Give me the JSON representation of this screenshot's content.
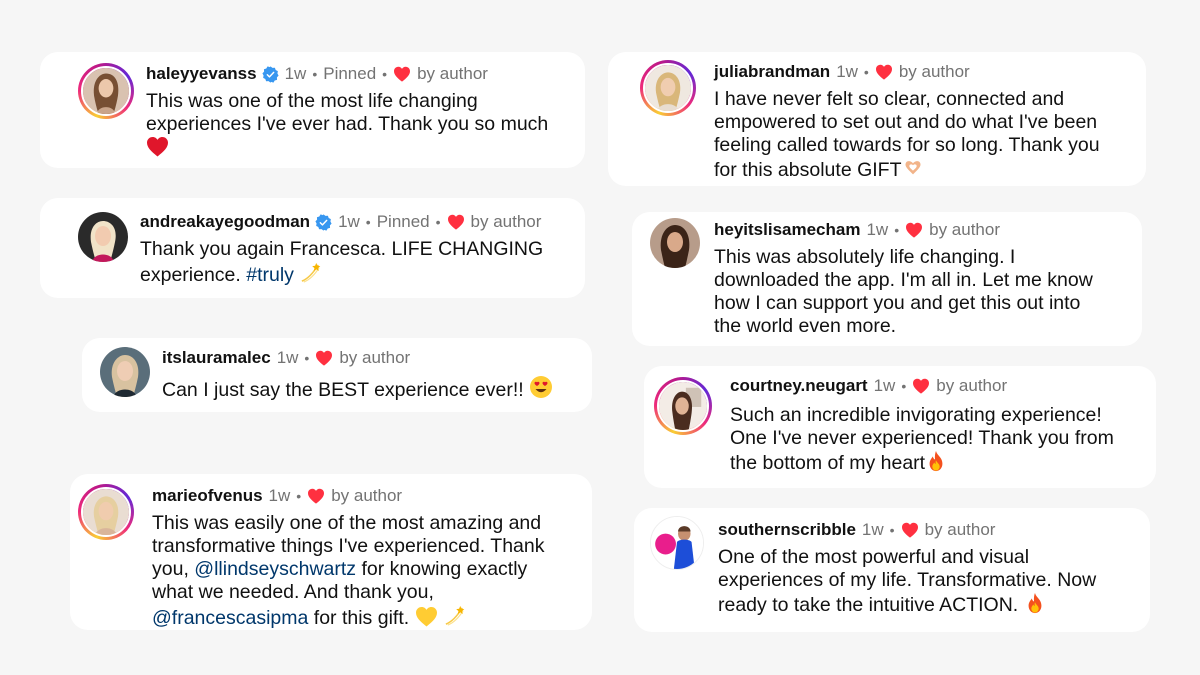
{
  "comments": [
    {
      "username": "haleyyevanss",
      "verified": true,
      "time": "1w",
      "pinned": "Pinned",
      "liked_by": "by author",
      "text_1": "This was one of the most life changing",
      "text_2": "experiences I've ever had. Thank you so much",
      "emoji": "red-heart"
    },
    {
      "username": "andreakayegoodman",
      "verified": true,
      "time": "1w",
      "pinned": "Pinned",
      "liked_by": "by author",
      "text_1": "Thank you again Francesca. LIFE CHANGING",
      "text_2": "experience.",
      "hashtag": "#truly",
      "emoji": "dizzy"
    },
    {
      "username": "itslauramalec",
      "time": "1w",
      "liked_by": "by author",
      "text_1": "Can I just say the BEST experience ever!!",
      "emoji": "heart-eyes"
    },
    {
      "username": "marieofvenus",
      "time": "1w",
      "liked_by": "by author",
      "text_1": "This was easily one of the most amazing and",
      "text_2": "transformative things I've experienced.  Thank",
      "text_3a": "you,",
      "mention_1": "@llindseyschwartz",
      "text_3b": "for knowing exactly",
      "text_4": "what we needed.  And thank you,",
      "mention_2": "@francescasipma",
      "text_5": "for this gift.",
      "emoji": "yellow-heart, dizzy"
    },
    {
      "username": "juliabrandman",
      "time": "1w",
      "liked_by": "by author",
      "text_1": "I have never felt so clear, connected and",
      "text_2": "empowered to set out and do what I've been",
      "text_3": "feeling called towards for so long. Thank you",
      "text_4": "for this absolute GIFT",
      "emoji": "heart-hands"
    },
    {
      "username": "heyitslisamecham",
      "time": "1w",
      "liked_by": "by author",
      "text_1": "This was absolutely life changing. I",
      "text_2": "downloaded the app. I'm all in. Let me know",
      "text_3": "how I can support you and get this out into",
      "text_4": "the world even more."
    },
    {
      "username": "courtney.neugart",
      "time": "1w",
      "liked_by": "by author",
      "text_1": "Such an incredible invigorating experience!",
      "text_2": "One I've never experienced! Thank you from",
      "text_3": "the bottom of my heart",
      "emoji": "fire"
    },
    {
      "username": "southernscribble",
      "time": "1w",
      "liked_by": "by author",
      "text_1": "One of the most powerful and visual",
      "text_2": "experiences of my life. Transformative. Now",
      "text_3": "ready to take the intuitive ACTION.",
      "emoji": "fire"
    }
  ],
  "colors": {
    "heart": "#ff3040",
    "verified": "#3897f0",
    "link": "#00376b",
    "meta": "#737373"
  }
}
